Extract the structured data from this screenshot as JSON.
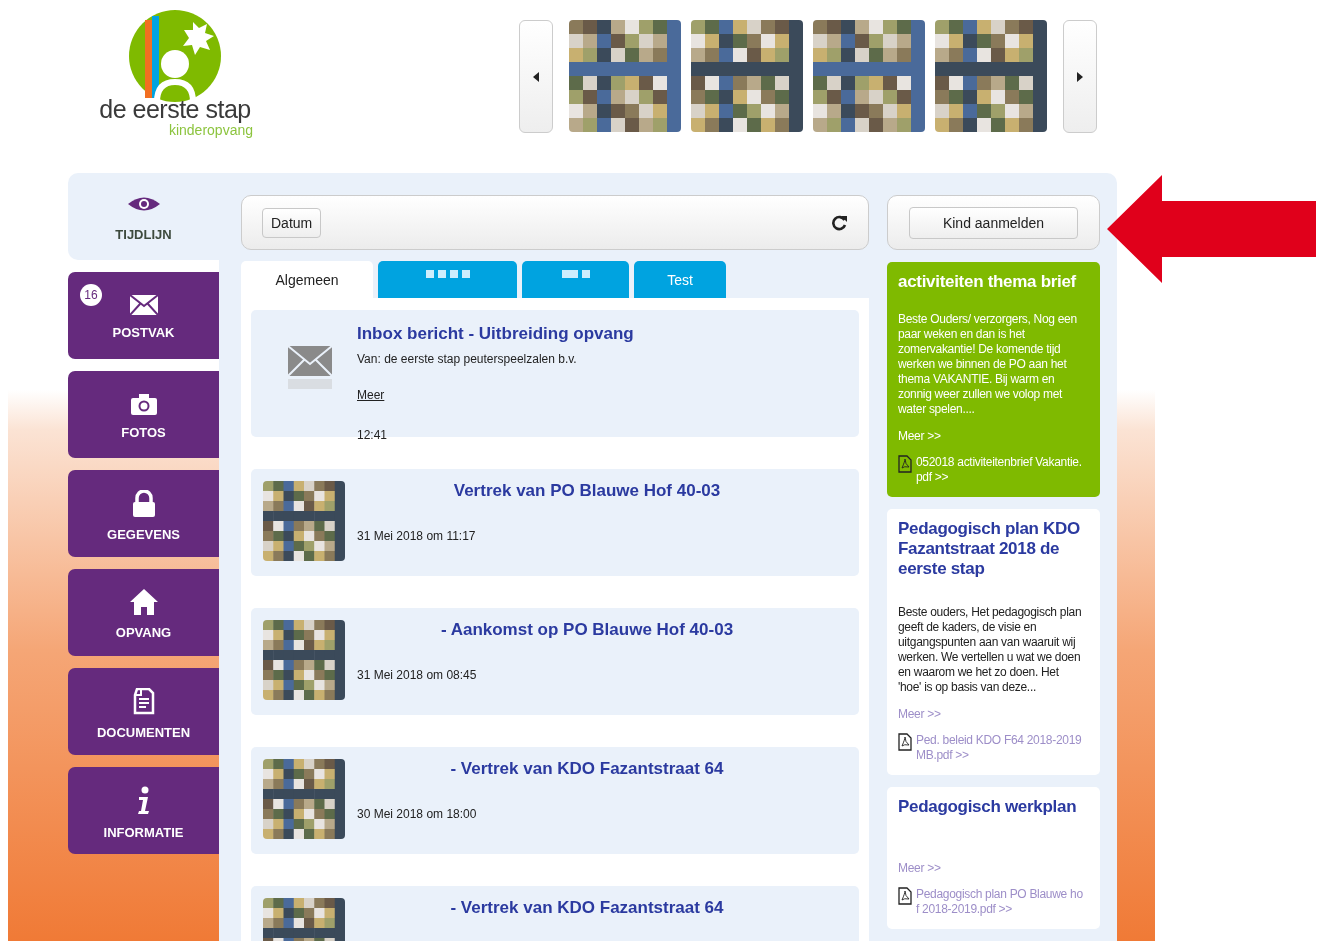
{
  "logo": {
    "name": "de eerste stap",
    "tagline": "kinderopvang"
  },
  "nav": [
    {
      "label": "TIJDLIJN",
      "selected": true
    },
    {
      "label": "POSTVAK",
      "badge": "16",
      "selected": false
    },
    {
      "label": "FOTOS",
      "selected": false
    },
    {
      "label": "GEGEVENS",
      "selected": false
    },
    {
      "label": "OPVANG",
      "selected": false
    },
    {
      "label": "DOCUMENTEN",
      "selected": false
    },
    {
      "label": "INFORMATIE",
      "selected": false
    }
  ],
  "toolbar": {
    "button": "Datum"
  },
  "tabs": [
    {
      "kind": "text",
      "label": "Algemeen",
      "selected": true
    },
    {
      "kind": "pixelated",
      "selected": false
    },
    {
      "kind": "pixelated",
      "selected": false
    },
    {
      "kind": "text",
      "label": "Test",
      "selected": false
    }
  ],
  "timeline": [
    {
      "kind": "message",
      "title": "Inbox bericht - Uitbreiding opvang",
      "sender": "Van: de eerste stap peuterspeelzalen b.v.",
      "link": "Meer",
      "time": "12:41"
    },
    {
      "kind": "event",
      "title": "Vertrek van PO Blauwe Hof 40-03",
      "time": "31 Mei 2018 om 11:17"
    },
    {
      "kind": "event",
      "title": "- Aankomst op PO Blauwe Hof 40-03",
      "time": "31 Mei 2018 om 08:45"
    },
    {
      "kind": "event",
      "title": "- Vertrek van KDO Fazantstraat 64",
      "time": "30 Mei 2018 om 18:00"
    },
    {
      "kind": "event",
      "title": "- Vertrek van KDO Fazantstraat 64"
    }
  ],
  "sidebar": {
    "button": "Kind aanmelden",
    "cards": [
      {
        "kind": "featured",
        "title": "activiteiten thema brief",
        "text": "Beste Ouders/ verzorgers, Nog een paar weken en dan is het zomervakantie! De komende tijd werken we binnen de PO aan het thema VAKANTIE. Bij warm en zonnig weer zullen we volop met water spelen....",
        "link": "Meer >>",
        "attachment": "052018 activiteitenbrief Vakantie.pdf >>"
      },
      {
        "kind": "plain",
        "title": "Pedagogisch plan KDO Fazantstraat 2018 de eerste stap",
        "text": "Beste ouders, Het pedagogisch plan geeft de kaders, de visie en uitgangspunten aan van waaruit wij werken. We vertellen u wat we doen en waarom we het zo doen. Het 'hoe' is op basis van deze...",
        "link": "Meer >>",
        "attachment": "Ped. beleid KDO F64 2018-2019 MB.pdf >>"
      },
      {
        "kind": "plain",
        "title": "Pedagogisch werkplan",
        "link": "Meer >>",
        "attachment": "Pedagogisch plan PO Blauwe hof 2018-2019.pdf >>"
      }
    ]
  }
}
